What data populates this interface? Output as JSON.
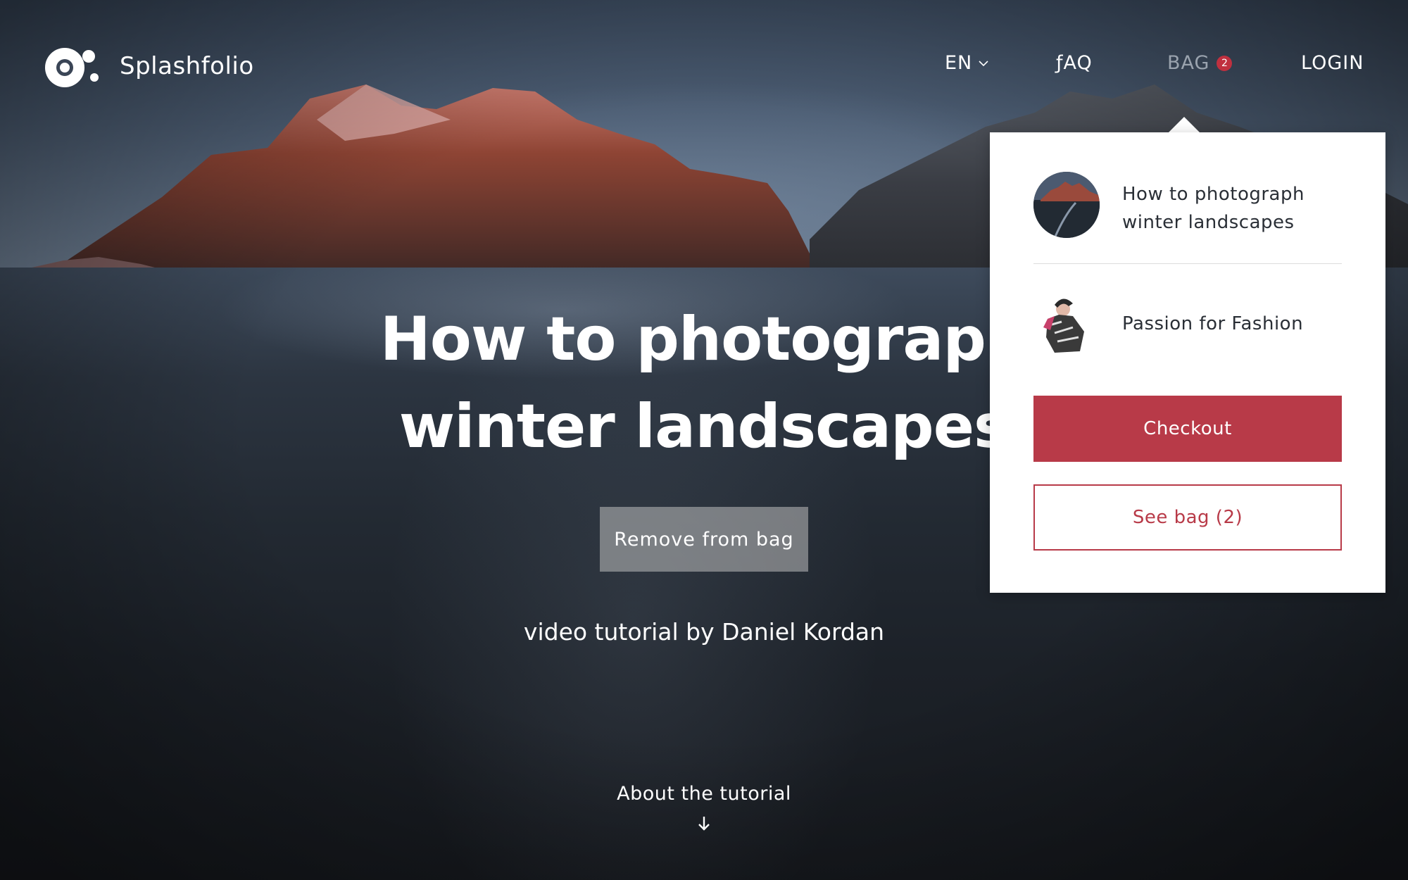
{
  "brand": {
    "name": "Splashfolio",
    "logo_icon": "splashfolio-logo-icon"
  },
  "nav": {
    "language": "EN",
    "faq": "ƒAQ",
    "bag": "BAG",
    "bag_count": "2",
    "login": "LOGIN"
  },
  "hero": {
    "title_line1": "How to photograph",
    "title_line2": "winter landscapes",
    "remove_button": "Remove from bag",
    "subtitle": "video tutorial by Daniel Kordan",
    "about_link": "About the tutorial"
  },
  "bag_panel": {
    "items": [
      {
        "title_line1": "How to photograph",
        "title_line2": "winter landscapes",
        "thumbnail": "landscape-thumbnail"
      },
      {
        "title": "Passion for Fashion",
        "thumbnail": "fashion-thumbnail"
      }
    ],
    "checkout_label": "Checkout",
    "see_bag_label": "See bag (2)"
  },
  "colors": {
    "accent": "#b83a48",
    "badge": "#c0303f",
    "bag_nav_muted": "#9aa3ae"
  }
}
